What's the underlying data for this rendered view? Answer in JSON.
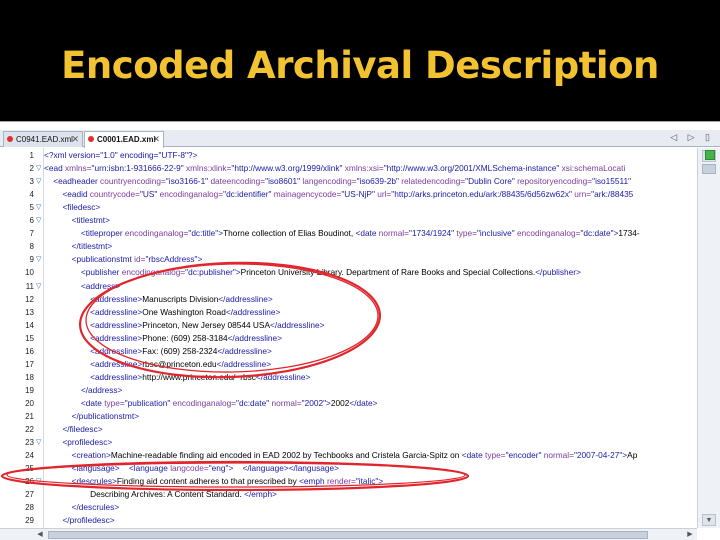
{
  "slide": {
    "title": "Encoded Archival Description"
  },
  "tabs": [
    {
      "label": "C0941.EAD.xml",
      "active": false
    },
    {
      "label": "C0001.EAD.xml",
      "active": true
    }
  ],
  "tab_nav": "◁ ▷ ▯",
  "icons": {
    "tab_modified": "red-dot-icon",
    "close": "close-icon",
    "fold": "fold-triangle-icon"
  },
  "colors": {
    "title": "#f2c230",
    "tag": "#1a1aa6",
    "attribute": "#7a3c9c",
    "annotation": "#e0262c"
  },
  "lines": [
    {
      "n": "1",
      "fold": false,
      "segs": [
        [
          "t",
          "<?xml version=\"1.0\" encoding=\"UTF-8\"?>"
        ]
      ]
    },
    {
      "n": "2",
      "fold": true,
      "segs": [
        [
          "t",
          "<ead"
        ],
        [
          "a",
          " xmlns="
        ],
        [
          "v",
          "\"urn:isbn:1-931666-22-9\""
        ],
        [
          "a",
          " xmlns:xlink="
        ],
        [
          "v",
          "\"http://www.w3.org/1999/xlink\""
        ],
        [
          "a",
          " xmlns:xsi="
        ],
        [
          "v",
          "\"http://www.w3.org/2001/XMLSchema-instance\""
        ],
        [
          "a",
          " xsi:schemaLocati"
        ]
      ]
    },
    {
      "n": "3",
      "fold": true,
      "segs": [
        [
          "t",
          "    <eadheader"
        ],
        [
          "a",
          " countryencoding="
        ],
        [
          "v",
          "\"iso3166-1\""
        ],
        [
          "a",
          " dateencoding="
        ],
        [
          "v",
          "\"iso8601\""
        ],
        [
          "a",
          " langencoding="
        ],
        [
          "v",
          "\"iso639-2b\""
        ],
        [
          "a",
          " relatedencoding="
        ],
        [
          "v",
          "\"Dublin Core\""
        ],
        [
          "a",
          " repositoryencoding="
        ],
        [
          "v",
          "\"iso15511\""
        ]
      ]
    },
    {
      "n": "4",
      "fold": false,
      "segs": [
        [
          "t",
          "        <eadid"
        ],
        [
          "a",
          " countrycode="
        ],
        [
          "v",
          "\"US\""
        ],
        [
          "a",
          " encodinganalog="
        ],
        [
          "v",
          "\"dc:identifier\""
        ],
        [
          "a",
          " mainagencycode="
        ],
        [
          "v",
          "\"US-NjP\""
        ],
        [
          "a",
          " url="
        ],
        [
          "v",
          "\"http://arks.princeton.edu/ark:/88435/6d56zw62x\""
        ],
        [
          "a",
          " urn="
        ],
        [
          "v",
          "\"ark:/88435"
        ]
      ]
    },
    {
      "n": "5",
      "fold": true,
      "segs": [
        [
          "t",
          "        <filedesc>"
        ]
      ]
    },
    {
      "n": "6",
      "fold": true,
      "segs": [
        [
          "t",
          "            <titlestmt>"
        ]
      ]
    },
    {
      "n": "7",
      "fold": false,
      "segs": [
        [
          "t",
          "                <titleproper"
        ],
        [
          "a",
          " encodinganalog="
        ],
        [
          "v",
          "\"dc:title\""
        ],
        [
          "t",
          ">"
        ],
        [
          "x",
          "Thorne collection of Elias Boudinot, "
        ],
        [
          "t",
          "<date"
        ],
        [
          "a",
          " normal="
        ],
        [
          "v",
          "\"1734/1924\""
        ],
        [
          "a",
          " type="
        ],
        [
          "v",
          "\"inclusive\""
        ],
        [
          "a",
          " encodinganalog="
        ],
        [
          "v",
          "\"dc:date\""
        ],
        [
          "t",
          ">"
        ],
        [
          "x",
          "1734-"
        ]
      ]
    },
    {
      "n": "8",
      "fold": false,
      "segs": [
        [
          "t",
          "            </titlestmt>"
        ]
      ]
    },
    {
      "n": "9",
      "fold": true,
      "segs": [
        [
          "t",
          "            <publicationstmt"
        ],
        [
          "a",
          " id="
        ],
        [
          "v",
          "\"rbscAddress\""
        ],
        [
          "t",
          ">"
        ]
      ]
    },
    {
      "n": "10",
      "fold": false,
      "segs": [
        [
          "t",
          "                <publisher"
        ],
        [
          "a",
          " encodinganalog="
        ],
        [
          "v",
          "\"dc:publisher\""
        ],
        [
          "t",
          ">"
        ],
        [
          "x",
          "Princeton University Library. Department of Rare Books and Special Collections."
        ],
        [
          "t",
          "</publisher>"
        ]
      ]
    },
    {
      "n": "11",
      "fold": true,
      "segs": [
        [
          "t",
          "                <address>"
        ]
      ]
    },
    {
      "n": "12",
      "fold": false,
      "segs": [
        [
          "t",
          "                    <addressline>"
        ],
        [
          "x",
          "Manuscripts Division"
        ],
        [
          "t",
          "</addressline>"
        ]
      ]
    },
    {
      "n": "13",
      "fold": false,
      "segs": [
        [
          "t",
          "                    <addressline>"
        ],
        [
          "x",
          "One Washington Road"
        ],
        [
          "t",
          "</addressline>"
        ]
      ]
    },
    {
      "n": "14",
      "fold": false,
      "segs": [
        [
          "t",
          "                    <addressline>"
        ],
        [
          "x",
          "Princeton, New Jersey 08544 USA"
        ],
        [
          "t",
          "</addressline>"
        ]
      ]
    },
    {
      "n": "15",
      "fold": false,
      "segs": [
        [
          "t",
          "                    <addressline>"
        ],
        [
          "x",
          "Phone: (609) 258-3184"
        ],
        [
          "t",
          "</addressline>"
        ]
      ]
    },
    {
      "n": "16",
      "fold": false,
      "segs": [
        [
          "t",
          "                    <addressline>"
        ],
        [
          "x",
          "Fax: (609) 258-2324"
        ],
        [
          "t",
          "</addressline>"
        ]
      ]
    },
    {
      "n": "17",
      "fold": false,
      "segs": [
        [
          "t",
          "                    <addressline>"
        ],
        [
          "x",
          "rbsc@princeton.edu"
        ],
        [
          "t",
          "</addressline>"
        ]
      ]
    },
    {
      "n": "18",
      "fold": false,
      "segs": [
        [
          "t",
          "                    <addressline>"
        ],
        [
          "x",
          "http://www.princeton.edu/~rbsc"
        ],
        [
          "t",
          "</addressline>"
        ]
      ]
    },
    {
      "n": "19",
      "fold": false,
      "segs": [
        [
          "t",
          "                </address>"
        ]
      ]
    },
    {
      "n": "20",
      "fold": false,
      "segs": [
        [
          "t",
          "                <date"
        ],
        [
          "a",
          " type="
        ],
        [
          "v",
          "\"publication\""
        ],
        [
          "a",
          " encodinganalog="
        ],
        [
          "v",
          "\"dc:date\""
        ],
        [
          "a",
          " normal="
        ],
        [
          "v",
          "\"2002\""
        ],
        [
          "t",
          ">"
        ],
        [
          "x",
          "2002"
        ],
        [
          "t",
          "</date>"
        ]
      ]
    },
    {
      "n": "21",
      "fold": false,
      "segs": [
        [
          "t",
          "            </publicationstmt>"
        ]
      ]
    },
    {
      "n": "22",
      "fold": false,
      "segs": [
        [
          "t",
          "        </filedesc>"
        ]
      ]
    },
    {
      "n": "23",
      "fold": true,
      "segs": [
        [
          "t",
          "        <profiledesc>"
        ]
      ]
    },
    {
      "n": "24",
      "fold": false,
      "segs": [
        [
          "t",
          "            <creation>"
        ],
        [
          "x",
          "Machine-readable finding aid encoded in EAD 2002 by Techbooks and Cristela Garcia-Spitz on "
        ],
        [
          "t",
          "<date"
        ],
        [
          "a",
          " type="
        ],
        [
          "v",
          "\"encoder\""
        ],
        [
          "a",
          " normal="
        ],
        [
          "v",
          "\"2007-04-27\""
        ],
        [
          "t",
          ">"
        ],
        [
          "x",
          "Ap"
        ]
      ]
    },
    {
      "n": "25",
      "fold": false,
      "segs": [
        [
          "t",
          "            <langusage>"
        ],
        [
          "x",
          "    "
        ],
        [
          "t",
          "<language"
        ],
        [
          "a",
          " langcode="
        ],
        [
          "v",
          "\"eng\""
        ],
        [
          "t",
          ">"
        ],
        [
          "x",
          "    "
        ],
        [
          "t",
          "</language></langusage>"
        ]
      ]
    },
    {
      "n": "26",
      "fold": true,
      "segs": [
        [
          "t",
          "            <descrules>"
        ],
        [
          "x",
          "Finding aid content adheres to that prescribed by "
        ],
        [
          "t",
          "<emph"
        ],
        [
          "a",
          " render="
        ],
        [
          "v",
          "\"italic\""
        ],
        [
          "t",
          ">"
        ]
      ]
    },
    {
      "n": "27",
      "fold": false,
      "segs": [
        [
          "x",
          "                    Describing Archives: A Content Standard. "
        ],
        [
          "t",
          "</emph>"
        ]
      ]
    },
    {
      "n": "28",
      "fold": false,
      "segs": [
        [
          "t",
          "            </descrules>"
        ]
      ]
    },
    {
      "n": "29",
      "fold": false,
      "segs": [
        [
          "t",
          "        </profiledesc>"
        ]
      ]
    }
  ]
}
